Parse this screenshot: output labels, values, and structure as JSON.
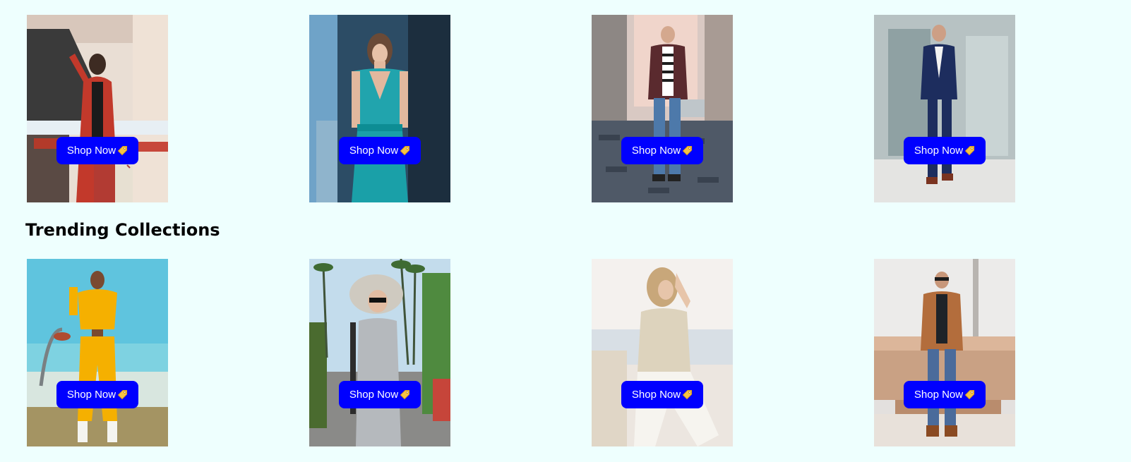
{
  "colors": {
    "page_background": "#eefffe",
    "button_background": "#0000ff",
    "button_text": "#ffffff"
  },
  "section": {
    "title": "Trending Collections"
  },
  "row1": [
    {
      "button_label": "Shop Now",
      "icon": "price-tag-icon",
      "photo": "woman-in-red-coat-with-shopping-bags"
    },
    {
      "button_label": "Shop Now",
      "icon": "price-tag-icon",
      "photo": "woman-in-teal-jumpsuit"
    },
    {
      "button_label": "Shop Now",
      "icon": "price-tag-icon",
      "photo": "man-in-maroon-jacket-on-cobblestone-street"
    },
    {
      "button_label": "Shop Now",
      "icon": "price-tag-icon",
      "photo": "man-in-navy-suit"
    }
  ],
  "row2": [
    {
      "button_label": "Shop Now",
      "icon": "price-tag-icon",
      "photo": "woman-in-yellow-tracksuit-at-basketball-court"
    },
    {
      "button_label": "Shop Now",
      "icon": "price-tag-icon",
      "photo": "woman-in-sun-hat-and-grey-dress"
    },
    {
      "button_label": "Shop Now",
      "icon": "price-tag-icon",
      "photo": "woman-in-beige-blouse-by-the-sea"
    },
    {
      "button_label": "Shop Now",
      "icon": "price-tag-icon",
      "photo": "man-in-brown-jacket-and-jeans"
    }
  ]
}
